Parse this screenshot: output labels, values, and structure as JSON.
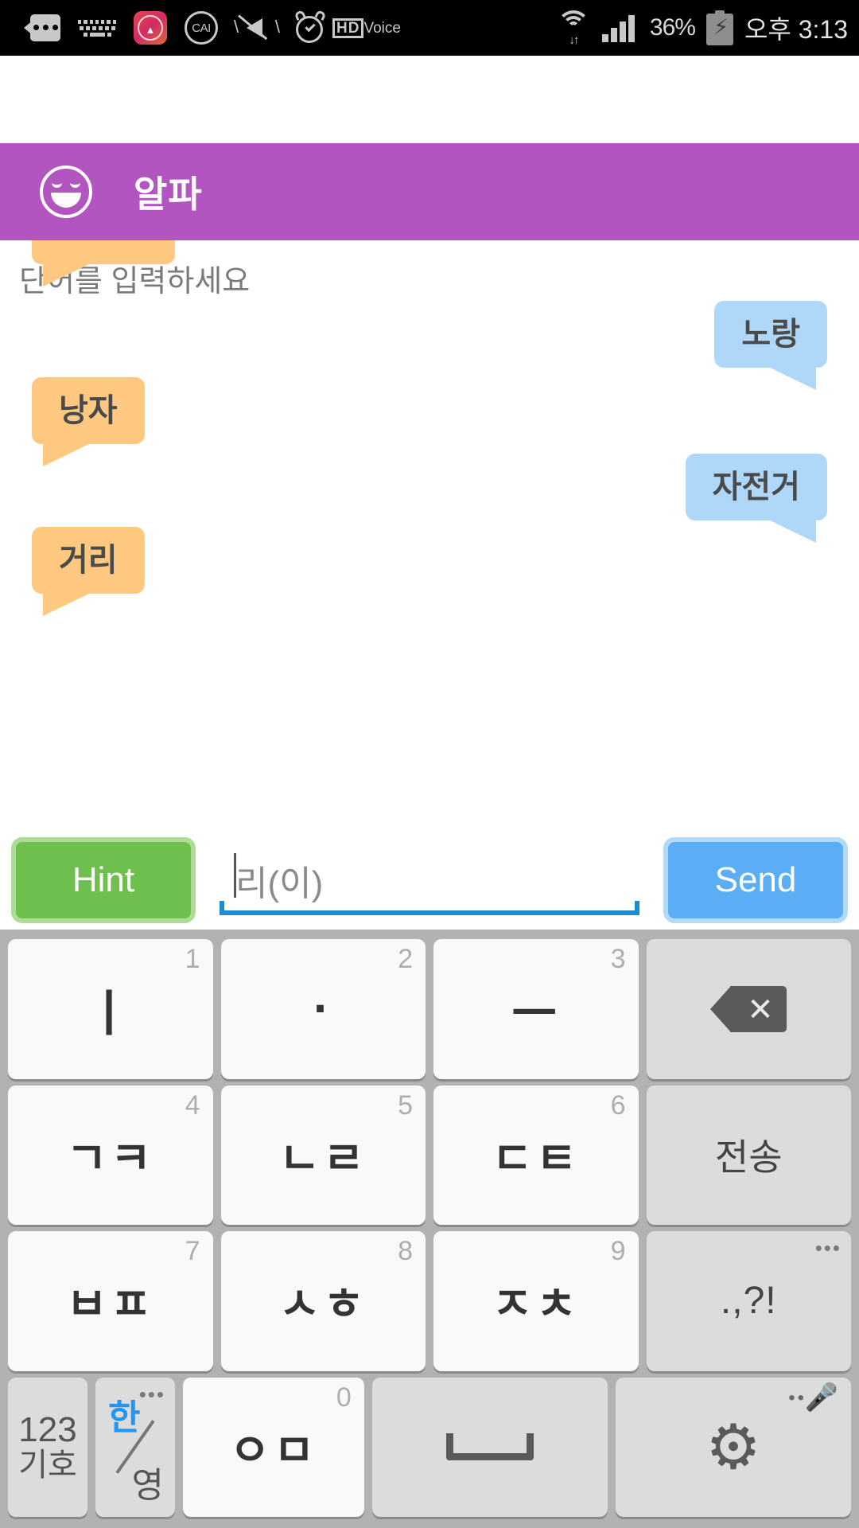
{
  "statusbar": {
    "battery_percent": "36%",
    "time": "오후 3:13",
    "icons": [
      "message-icon",
      "keyboard-icon",
      "wifi-hotspot-app-icon",
      "cai-icon",
      "mute-vibrate-icon",
      "alarm-icon",
      "hd-voice-icon",
      "wifi-icon",
      "signal-icon",
      "battery-charging-icon"
    ],
    "hd_label": "HD",
    "voice_label": "Voice"
  },
  "appbar": {
    "title": "알파",
    "icon": "smiley-face-icon",
    "bg_color": "#B355C0"
  },
  "chat": {
    "prompt": "단어를 입력하세요",
    "messages": [
      {
        "text": "",
        "side": "left",
        "clipped": true
      },
      {
        "text": "노랑",
        "side": "right",
        "clipped": false
      },
      {
        "text": "낭자",
        "side": "left",
        "clipped": false
      },
      {
        "text": "자전거",
        "side": "right",
        "clipped": false
      },
      {
        "text": "거리",
        "side": "left",
        "clipped": false
      }
    ],
    "left_bubble_color": "#FFC880",
    "right_bubble_color": "#AFD8F8"
  },
  "inputbar": {
    "hint_label": "Hint",
    "send_label": "Send",
    "input_value": "리(이)",
    "hint_color": "#6FBF4F",
    "send_color": "#5BAEF5",
    "underline_color": "#1A8FD0"
  },
  "keyboard": {
    "rows": [
      [
        {
          "name": "key-i",
          "glyph": "ㅣ",
          "num": "1",
          "style": "white"
        },
        {
          "name": "key-dot",
          "glyph": "·",
          "num": "2",
          "style": "white"
        },
        {
          "name": "key-eu",
          "glyph": "ㅡ",
          "num": "3",
          "style": "white"
        },
        {
          "name": "key-backspace",
          "glyph": "",
          "num": "",
          "style": "grey"
        }
      ],
      [
        {
          "name": "key-giyeok-kieuk",
          "glyph": "ㄱㅋ",
          "num": "4",
          "style": "white"
        },
        {
          "name": "key-nieun-rieul",
          "glyph": "ㄴㄹ",
          "num": "5",
          "style": "white"
        },
        {
          "name": "key-digeut-tieut",
          "glyph": "ㄷㅌ",
          "num": "6",
          "style": "white"
        },
        {
          "name": "key-send",
          "glyph": "전송",
          "num": "",
          "style": "grey"
        }
      ],
      [
        {
          "name": "key-bieup-pieup",
          "glyph": "ㅂㅍ",
          "num": "7",
          "style": "white"
        },
        {
          "name": "key-siot-hieut",
          "glyph": "ㅅㅎ",
          "num": "8",
          "style": "white"
        },
        {
          "name": "key-jieut-chieut",
          "glyph": "ㅈㅊ",
          "num": "9",
          "style": "white"
        },
        {
          "name": "key-punctuation",
          "glyph": ".,?!",
          "num": "",
          "style": "grey"
        }
      ],
      [
        {
          "name": "key-numeric-symbol",
          "glyph": "123\n기호",
          "num": "",
          "style": "grey"
        },
        {
          "name": "key-language-toggle",
          "glyph": "한/영",
          "num": "",
          "style": "grey"
        },
        {
          "name": "key-ieung-mieum",
          "glyph": "ㅇㅁ",
          "num": "0",
          "style": "white"
        },
        {
          "name": "key-space",
          "glyph": "",
          "num": "",
          "style": "grey"
        },
        {
          "name": "key-settings",
          "glyph": "",
          "num": "",
          "style": "grey"
        }
      ]
    ],
    "num_symbol_line1": "123",
    "num_symbol_line2": "기호",
    "lang_korean": "한",
    "lang_english": "영",
    "send_key_label": "전송",
    "punctuation_label": ".,?!",
    "bg_color": "#B0B2B4"
  }
}
